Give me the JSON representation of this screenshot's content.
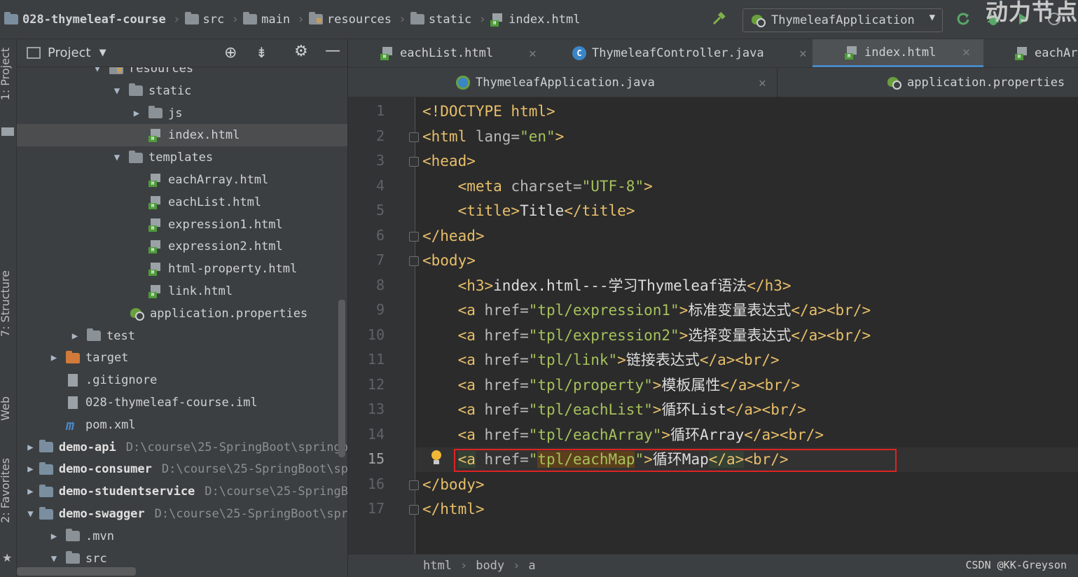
{
  "breadcrumbs": [
    "028-thymeleaf-course",
    "src",
    "main",
    "resources",
    "static",
    "index.html"
  ],
  "run_config": {
    "label": "ThymeleafApplication"
  },
  "watermark": "动力节点",
  "project_panel": {
    "title": "Project"
  },
  "side_tabs": [
    "1: Project",
    "7: Structure",
    "Web",
    "2: Favorites"
  ],
  "tree": [
    {
      "label": "resources",
      "icon": "folder-res",
      "arrow": "down"
    },
    {
      "label": "static",
      "icon": "folder",
      "arrow": "down"
    },
    {
      "label": "js",
      "icon": "folder",
      "arrow": "right"
    },
    {
      "label": "index.html",
      "icon": "html",
      "arrow": "",
      "selected": true
    },
    {
      "label": "templates",
      "icon": "folder",
      "arrow": "down"
    },
    {
      "label": "eachArray.html",
      "icon": "html",
      "arrow": ""
    },
    {
      "label": "eachList.html",
      "icon": "html",
      "arrow": ""
    },
    {
      "label": "expression1.html",
      "icon": "html",
      "arrow": ""
    },
    {
      "label": "expression2.html",
      "icon": "html",
      "arrow": ""
    },
    {
      "label": "html-property.html",
      "icon": "html",
      "arrow": ""
    },
    {
      "label": "link.html",
      "icon": "html",
      "arrow": ""
    },
    {
      "label": "application.properties",
      "icon": "props",
      "arrow": ""
    },
    {
      "label": "test",
      "icon": "folder",
      "arrow": "right"
    },
    {
      "label": "target",
      "icon": "folder-orange",
      "arrow": "right"
    },
    {
      "label": ".gitignore",
      "icon": "file",
      "arrow": ""
    },
    {
      "label": "028-thymeleaf-course.iml",
      "icon": "file",
      "arrow": ""
    },
    {
      "label": "pom.xml",
      "icon": "maven",
      "arrow": ""
    },
    {
      "label": "demo-api",
      "icon": "module",
      "arrow": "right",
      "path": "D:\\course\\25-SpringBoot\\springb"
    },
    {
      "label": "demo-consumer",
      "icon": "module",
      "arrow": "right",
      "path": "D:\\course\\25-SpringBoot\\sp"
    },
    {
      "label": "demo-studentservice",
      "icon": "module",
      "arrow": "right",
      "path": "D:\\course\\25-SpringB"
    },
    {
      "label": "demo-swagger",
      "icon": "module",
      "arrow": "down",
      "path": "D:\\course\\25-SpringBoot\\spr"
    },
    {
      "label": ".mvn",
      "icon": "folder",
      "arrow": "right"
    },
    {
      "label": "src",
      "icon": "folder",
      "arrow": "down"
    }
  ],
  "tabs_row1": [
    {
      "label": "eachList.html",
      "icon": "html"
    },
    {
      "label": "ThymeleafController.java",
      "icon": "java"
    },
    {
      "label": "index.html",
      "icon": "html",
      "active": true
    },
    {
      "label": "eachAr",
      "icon": "html"
    }
  ],
  "tabs_row2": [
    {
      "label": "ThymeleafApplication.java",
      "icon": "springboot"
    },
    {
      "label": "application.properties",
      "icon": "props"
    }
  ],
  "code_lines": [
    {
      "n": "1",
      "parts": [
        [
          "tg",
          "<!DOCTYPE html>"
        ]
      ]
    },
    {
      "n": "2",
      "parts": [
        [
          "tg",
          "<html "
        ],
        [
          "at",
          "lang="
        ],
        [
          "st",
          "\"en\""
        ],
        [
          "tg",
          ">"
        ]
      ]
    },
    {
      "n": "3",
      "parts": [
        [
          "tg",
          "<head>"
        ]
      ]
    },
    {
      "n": "4",
      "parts": [
        [
          "tx",
          "    "
        ],
        [
          "tg",
          "<meta "
        ],
        [
          "at",
          "charset="
        ],
        [
          "st",
          "\"UTF-8\""
        ],
        [
          "tg",
          ">"
        ]
      ]
    },
    {
      "n": "5",
      "parts": [
        [
          "tx",
          "    "
        ],
        [
          "tg",
          "<title>"
        ],
        [
          "tx",
          "Title"
        ],
        [
          "tg",
          "</title>"
        ]
      ]
    },
    {
      "n": "6",
      "parts": [
        [
          "tg",
          "</head>"
        ]
      ]
    },
    {
      "n": "7",
      "parts": [
        [
          "tg",
          "<body>"
        ]
      ]
    },
    {
      "n": "8",
      "parts": [
        [
          "tx",
          "    "
        ],
        [
          "tg",
          "<h3>"
        ],
        [
          "tx",
          "index.html---学习Thymeleaf语法"
        ],
        [
          "tg",
          "</h3>"
        ]
      ]
    },
    {
      "n": "9",
      "parts": [
        [
          "tx",
          "    "
        ],
        [
          "tg",
          "<a "
        ],
        [
          "at",
          "href="
        ],
        [
          "st",
          "\"tpl/expression1\""
        ],
        [
          "tg",
          ">"
        ],
        [
          "tx",
          "标准变量表达式"
        ],
        [
          "tg",
          "</a><br/>"
        ]
      ]
    },
    {
      "n": "10",
      "parts": [
        [
          "tx",
          "    "
        ],
        [
          "tg",
          "<a "
        ],
        [
          "at",
          "href="
        ],
        [
          "st",
          "\"tpl/expression2\""
        ],
        [
          "tg",
          ">"
        ],
        [
          "tx",
          "选择变量表达式"
        ],
        [
          "tg",
          "</a><br/>"
        ]
      ]
    },
    {
      "n": "11",
      "parts": [
        [
          "tx",
          "    "
        ],
        [
          "tg",
          "<a "
        ],
        [
          "at",
          "href="
        ],
        [
          "st",
          "\"tpl/link\""
        ],
        [
          "tg",
          ">"
        ],
        [
          "tx",
          "链接表达式"
        ],
        [
          "tg",
          "</a><br/>"
        ]
      ]
    },
    {
      "n": "12",
      "parts": [
        [
          "tx",
          "    "
        ],
        [
          "tg",
          "<a "
        ],
        [
          "at",
          "href="
        ],
        [
          "st",
          "\"tpl/property\""
        ],
        [
          "tg",
          ">"
        ],
        [
          "tx",
          "模板属性"
        ],
        [
          "tg",
          "</a><br/>"
        ]
      ]
    },
    {
      "n": "13",
      "parts": [
        [
          "tx",
          "    "
        ],
        [
          "tg",
          "<a "
        ],
        [
          "at",
          "href="
        ],
        [
          "st",
          "\"tpl/eachList\""
        ],
        [
          "tg",
          ">"
        ],
        [
          "tx",
          "循环List"
        ],
        [
          "tg",
          "</a><br/>"
        ]
      ]
    },
    {
      "n": "14",
      "parts": [
        [
          "tx",
          "    "
        ],
        [
          "tg",
          "<a "
        ],
        [
          "at",
          "href="
        ],
        [
          "st",
          "\"tpl/eachArray\""
        ],
        [
          "tg",
          ">"
        ],
        [
          "tx",
          "循环Array"
        ],
        [
          "tg",
          "</a><br/>"
        ]
      ]
    },
    {
      "n": "15",
      "parts": [
        [
          "tx",
          "    "
        ],
        [
          "tg selhl",
          "<a"
        ],
        [
          "tg",
          " "
        ],
        [
          "at",
          "href="
        ],
        [
          "st",
          "\""
        ],
        [
          "st tplhl",
          "tpl/eachMap"
        ],
        [
          "st",
          "\""
        ],
        [
          "tg",
          ">"
        ],
        [
          "tx",
          "循环Map"
        ],
        [
          "tg selhl",
          "</a>"
        ],
        [
          "tg",
          "<br/>"
        ]
      ],
      "current": true
    },
    {
      "n": "16",
      "parts": [
        [
          "tg",
          "</body>"
        ]
      ]
    },
    {
      "n": "17",
      "parts": [
        [
          "tg",
          "</html>"
        ]
      ]
    }
  ],
  "status_path": [
    "html",
    "body",
    "a"
  ],
  "footer_credit": "CSDN @KK-Greyson"
}
